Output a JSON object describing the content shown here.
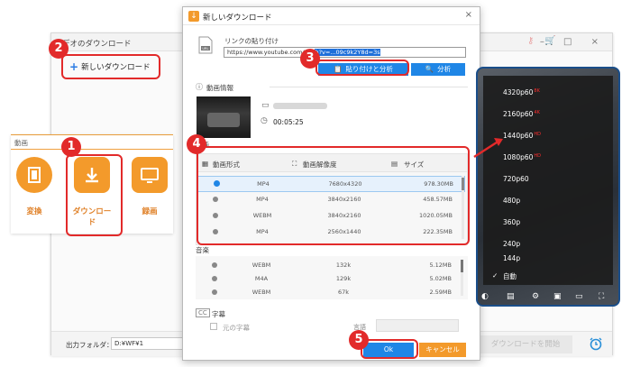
{
  "background_window": {
    "title": "デオのダウンロード",
    "new_download": "新しいダウンロード",
    "output_folder_label": "出力フォルダ：",
    "output_folder_value": "D:¥WF¥1",
    "start_button": "ダウンロードを開始",
    "window_controls": "– □ ×",
    "icons": [
      "key-icon",
      "cart-icon",
      "alarm-clock-icon"
    ]
  },
  "category_panel": {
    "header": "動画",
    "tiles": [
      {
        "label": "変換",
        "icon": "film-icon"
      },
      {
        "label": "ダウンロード",
        "icon": "download-arrow-icon"
      },
      {
        "label": "録画",
        "icon": "screen-record-icon"
      }
    ],
    "accent_color": "#f39a2b"
  },
  "dialog": {
    "title": "新しいダウンロード",
    "close": "×",
    "url_label": "リンクの貼り付け",
    "url_value": "https://www.youtube.com/watch?v=...09c9k2Y8d=3s",
    "url_value_prefix": "https://www.youtube.com/wat",
    "url_value_selected": "h?v=...09c9k2Y8d=3s",
    "paste_analyze_button": "貼り付けと分析",
    "analyze_button": "分析",
    "info_label": "動画情報",
    "duration": "00:05:25",
    "video_section_label": "動画",
    "columns": [
      "動画形式",
      "動画解像度",
      "サイズ"
    ],
    "video_rows": [
      {
        "format": "MP4",
        "resolution": "7680x4320",
        "size": "978.30MB",
        "selected": true
      },
      {
        "format": "MP4",
        "resolution": "3840x2160",
        "size": "458.57MB",
        "selected": false
      },
      {
        "format": "WEBM",
        "resolution": "3840x2160",
        "size": "1020.05MB",
        "selected": false
      },
      {
        "format": "MP4",
        "resolution": "2560x1440",
        "size": "222.35MB",
        "selected": false
      }
    ],
    "music_section_label": "音楽",
    "audio_rows": [
      {
        "format": "WEBM",
        "bitrate": "132k",
        "size": "5.12MB"
      },
      {
        "format": "M4A",
        "bitrate": "129k",
        "size": "5.02MB"
      },
      {
        "format": "WEBM",
        "bitrate": "67k",
        "size": "2.59MB"
      }
    ],
    "subtitle_icon": "CC",
    "subtitle_label": "字幕",
    "subtitle_original": "元の字幕",
    "language_label": "言語",
    "ok_button": "Ok",
    "cancel_button": "キャンセル",
    "primary_color": "#1f86e6"
  },
  "player": {
    "qualities": [
      {
        "label": "4320p60",
        "hd": "8K"
      },
      {
        "label": "2160p60",
        "hd": "4K"
      },
      {
        "label": "1440p60",
        "hd": "HD"
      },
      {
        "label": "1080p60",
        "hd": "HD"
      },
      {
        "label": "720p60",
        "hd": ""
      },
      {
        "label": "480p",
        "hd": ""
      },
      {
        "label": "360p",
        "hd": ""
      },
      {
        "label": "240p",
        "hd": ""
      },
      {
        "label": "144p",
        "hd": ""
      },
      {
        "label": "自動",
        "hd": "",
        "checked": true
      }
    ],
    "controls": [
      "toggle-icon",
      "subtitles-icon",
      "settings-icon",
      "miniplayer-icon",
      "theater-icon",
      "fullscreen-icon"
    ]
  },
  "callouts": [
    "1",
    "2",
    "3",
    "4",
    "5"
  ],
  "callout_color": "#e22a2a"
}
